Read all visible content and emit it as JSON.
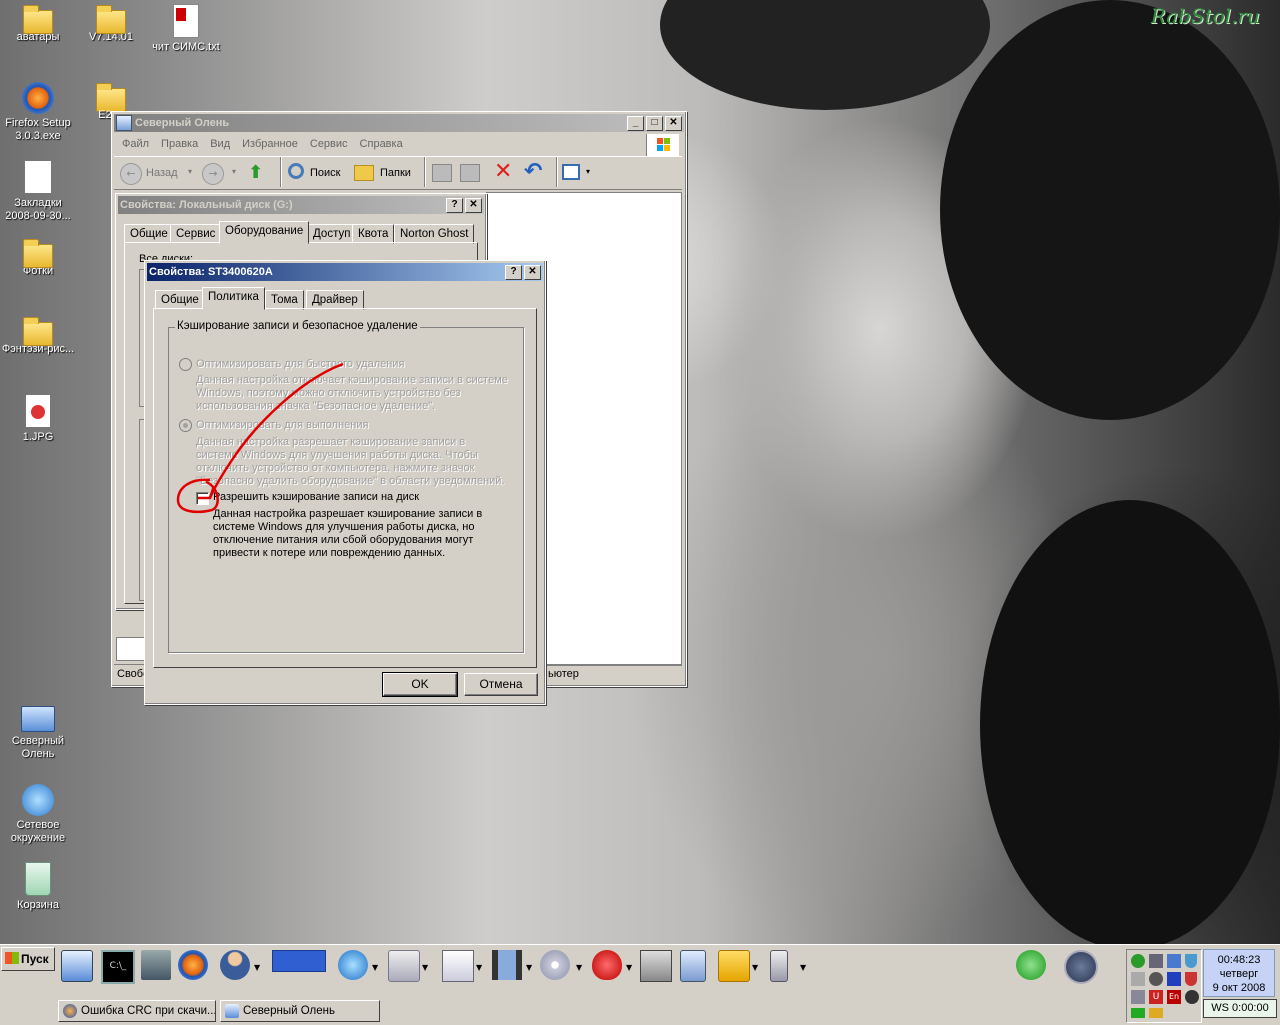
{
  "desktop": {
    "watermark": "RabStol.ru",
    "icons": [
      {
        "label": "аватары"
      },
      {
        "label": "V7.14.01"
      },
      {
        "label": "чит СИМС.txt"
      },
      {
        "label": "Firefox Setup 3.0.3.exe"
      },
      {
        "label": "E2"
      },
      {
        "label": "Закладки 2008-09-30..."
      },
      {
        "label": "Фотки"
      },
      {
        "label": "Фэнтэзи-рис..."
      },
      {
        "label": "1.JPG"
      },
      {
        "label": "Северный Олень"
      },
      {
        "label": "Сетевое окружение"
      },
      {
        "label": "Корзина"
      }
    ]
  },
  "explorer": {
    "title": "Северный Олень",
    "menu": [
      "Файл",
      "Правка",
      "Вид",
      "Избранное",
      "Сервис",
      "Справка"
    ],
    "toolbar": {
      "back": "Назад",
      "search": "Поиск",
      "folders": "Папки"
    },
    "status_left": "Свобо",
    "status_right": "ьютер"
  },
  "disk_props": {
    "title": "Свойства: Локальный диск (G:)",
    "tabs": [
      "Общие",
      "Сервис",
      "Оборудование",
      "Доступ",
      "Квота",
      "Norton Ghost"
    ],
    "selected_tab": "Оборудование",
    "partial_label": "Все диски:"
  },
  "dev_props": {
    "title": "Свойства: ST3400620A",
    "tabs": [
      "Общие",
      "Политика",
      "Тома",
      "Драйвер"
    ],
    "selected_tab": "Политика",
    "group_title": "Кэширование записи и безопасное удаление",
    "option1": {
      "label": "Оптимизировать для быстрого удаления",
      "desc": [
        "Данная настройка отключает кэширование записи в системе",
        "Windows, поэтому можно отключить устройство без",
        "использования значка \"Безопасное удаление\"."
      ]
    },
    "option2": {
      "label": "Оптимизировать для выполнения",
      "desc": [
        "Данная настройка разрешает кэширование записи в",
        "системе Windows для улучшения работы диска. Чтобы",
        "отключить устройство от компьютера, нажмите значок",
        "\"Безопасно удалить оборудование\" в области уведомлений."
      ]
    },
    "checkbox": {
      "label": "Разрешить кэширование записи на диск",
      "checked": false,
      "desc": [
        "Данная настройка разрешает кэширование записи в",
        "системе Windows для улучшения работы диска, но",
        "отключение питания или сбой оборудования могут",
        "привести к потере или повреждению данных."
      ]
    },
    "ok": "OK",
    "cancel": "Отмена"
  },
  "taskbar": {
    "start": "Пуск",
    "tasks": [
      "Ошибка CRC при скачи...",
      "Северный Олень"
    ],
    "clock": {
      "time": "00:48:23",
      "day": "четверг",
      "date": "9 окт 2008"
    },
    "ws": "WS 0:00:00"
  },
  "colors": {
    "title_active": "#0a246a",
    "annotation": "#e00000",
    "face": "#d4d0c8"
  }
}
